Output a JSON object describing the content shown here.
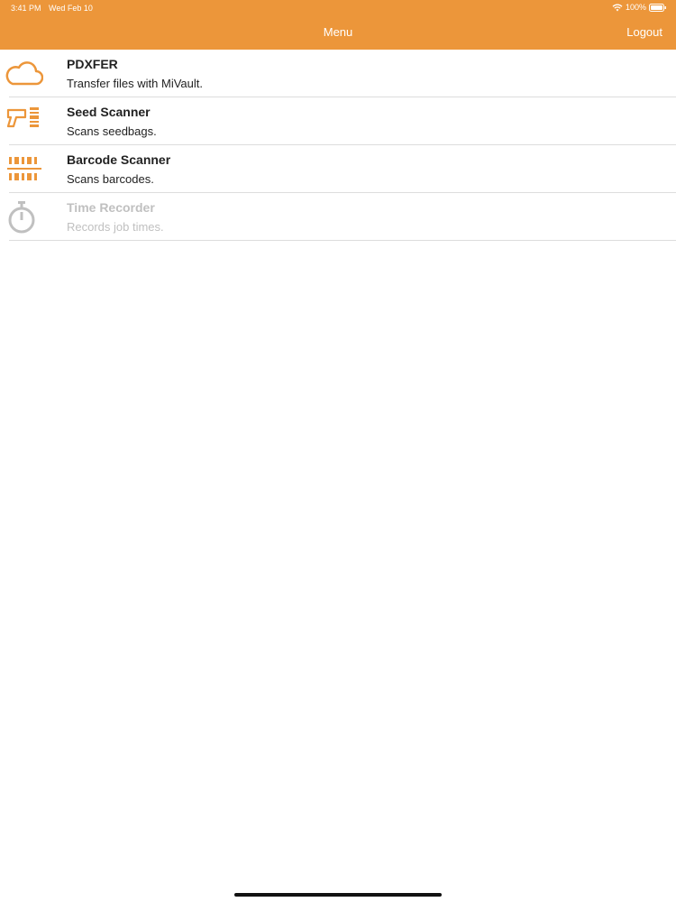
{
  "status_bar": {
    "time": "3:41 PM",
    "date": "Wed Feb 10",
    "battery": "100%",
    "icons": [
      "wifi-icon",
      "battery-icon"
    ]
  },
  "nav": {
    "title": "Menu",
    "logout_label": "Logout"
  },
  "menu": {
    "items": [
      {
        "title": "PDXFER",
        "subtitle": "Transfer files with MiVault.",
        "icon": "cloud-icon",
        "enabled": true
      },
      {
        "title": "Seed Scanner",
        "subtitle": "Scans seedbags.",
        "icon": "scanner-gun-icon",
        "enabled": true
      },
      {
        "title": "Barcode Scanner",
        "subtitle": "Scans barcodes.",
        "icon": "barcode-icon",
        "enabled": true
      },
      {
        "title": "Time Recorder",
        "subtitle": "Records job times.",
        "icon": "stopwatch-icon",
        "enabled": false
      }
    ]
  },
  "colors": {
    "accent": "#EC963A",
    "disabled": "#C0C0C0"
  }
}
